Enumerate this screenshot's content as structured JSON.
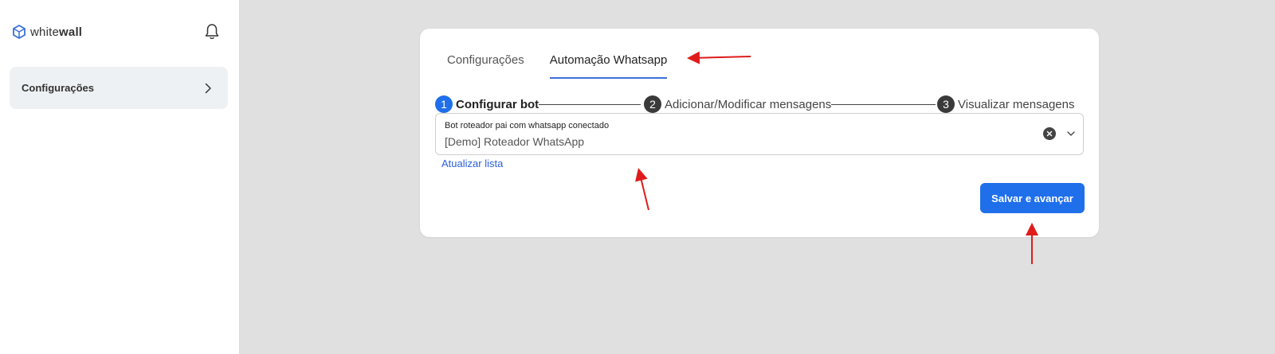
{
  "sidebar": {
    "logo": {
      "prefix": "white",
      "suffix": "wall"
    },
    "items": [
      {
        "label": "Configurações"
      }
    ]
  },
  "tabs": [
    {
      "label": "Configurações",
      "active": false
    },
    {
      "label": "Automação Whatsapp",
      "active": true
    }
  ],
  "stepper": [
    {
      "number": "1",
      "label": "Configurar bot",
      "active": true
    },
    {
      "number": "2",
      "label": "Adicionar/Modificar mensagens",
      "active": false
    },
    {
      "number": "3",
      "label": "Visualizar mensagens",
      "active": false
    }
  ],
  "bot_select": {
    "label": "Bot roteador pai com whatsapp conectado",
    "value": "[Demo] Roteador WhatsApp"
  },
  "refresh_link": "Atualizar lista",
  "save_button": "Salvar e avançar",
  "colors": {
    "primary": "#1f6feb",
    "annotation_arrow": "#e01b1b",
    "background": "#e0e0e0"
  },
  "icons": [
    "logo-cube-icon",
    "bell-icon",
    "chevron-right-icon",
    "clear-icon",
    "chevron-down-icon"
  ]
}
